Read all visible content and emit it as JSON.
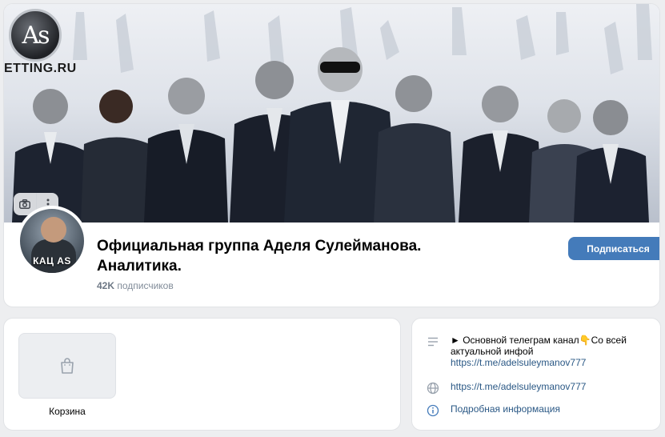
{
  "cover": {
    "logo_text": "As",
    "logo_caption": "ETTING.RU",
    "camera_icon": "camera-icon",
    "more_icon": "more-vertical-icon"
  },
  "group": {
    "title": "Официальная группа Аделя Сулейманова. Аналитика.",
    "subscribers_count": "42K",
    "subscribers_label": "подписчиков",
    "subscribe_label": "Подписаться",
    "avatar_caption": "КАЦ AS"
  },
  "shop": {
    "label": "Корзина",
    "icon": "shopping-bag-icon"
  },
  "info": {
    "description": "► Основной телеграм канал👇Со всей актуальной инфой",
    "description_link": "https://t.me/adelsuleymanov777",
    "website": "https://t.me/adelsuleymanov777",
    "more_info": "Подробная информация"
  },
  "colors": {
    "accent": "#447bba",
    "link": "#2a5885",
    "background": "#edeef0"
  }
}
